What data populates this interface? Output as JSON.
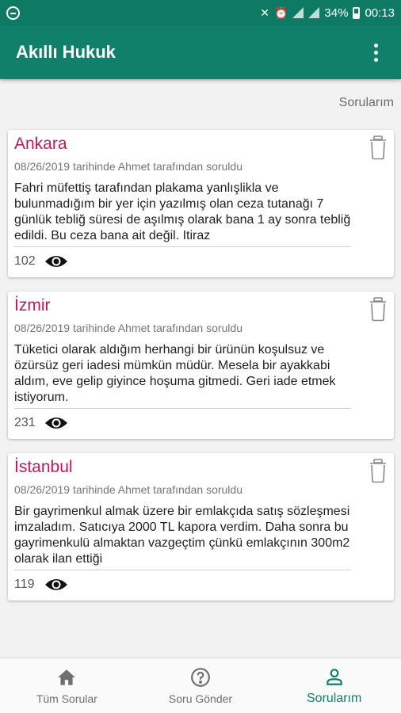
{
  "status_bar": {
    "battery": "34%",
    "time": "00:13"
  },
  "app_bar": {
    "title": "Akıllı Hukuk"
  },
  "section": {
    "label": "Sorularım"
  },
  "questions": [
    {
      "city": "Ankara",
      "meta": "08/26/2019 tarihinde Ahmet tarafından soruldu",
      "text": "Fahri müfettiş tarafından plakama yanlışlikla ve bulunmadığım bir yer için yazılmış olan ceza tutanağı 7 günlük tebliğ süresi de aşılmış olarak bana 1 ay sonra tebliğ edildi. Bu ceza bana ait değil. Itiraz",
      "views": "102"
    },
    {
      "city": "İzmir",
      "meta": "08/26/2019 tarihinde Ahmet tarafından soruldu",
      "text": "Tüketici olarak aldığım herhangi bir ürünün koşulsuz ve özürsüz geri iadesi mümkün müdür. Mesela bir ayakkabi aldım, eve gelip giyince hoşuma gitmedi. Geri iade etmek istiyorum.",
      "views": "231"
    },
    {
      "city": "İstanbul",
      "meta": "08/26/2019 tarihinde Ahmet tarafından soruldu",
      "text": "Bir gayrimenkul almak üzere bir emlakçıda satış sözleşmesi imzaladım. Satıcıya 2000 TL kapora verdim. Daha sonra bu gayrimenkulü almaktan vazgeçtim çünkü emlakçının 300m2 olarak ilan ettiği",
      "views": "119"
    }
  ],
  "bottom_nav": [
    {
      "label": "Tüm Sorular",
      "icon": "home-icon"
    },
    {
      "label": "Soru Gönder",
      "icon": "help-circle-icon"
    },
    {
      "label": "Sorularım",
      "icon": "person-icon",
      "active": true
    }
  ],
  "colors": {
    "primary": "#11806b",
    "city": "#c2185b"
  }
}
